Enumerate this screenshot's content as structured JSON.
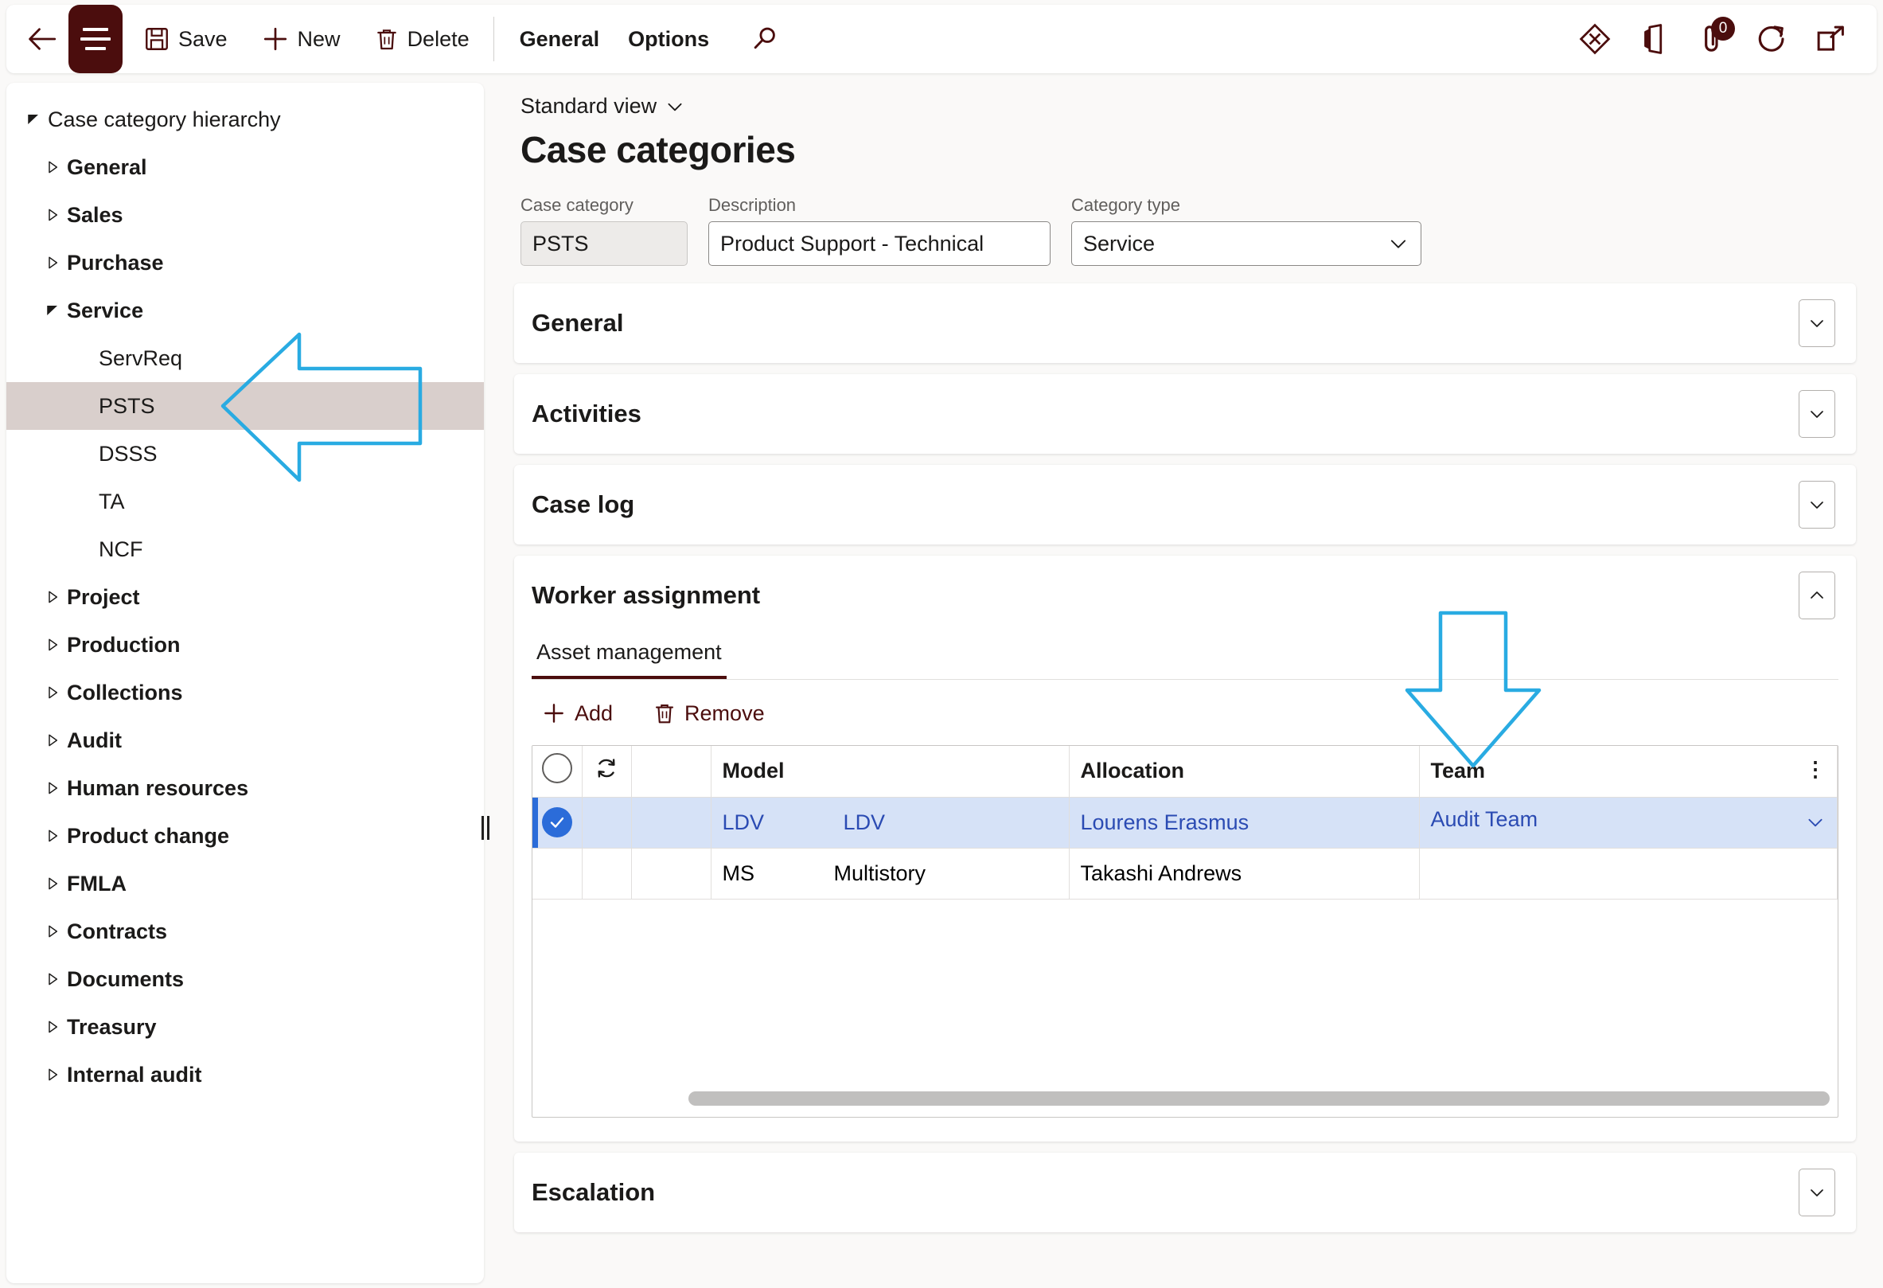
{
  "toolbar": {
    "back_label": "Back",
    "menu_icon": "hamburger-menu-icon",
    "save_label": "Save",
    "new_label": "New",
    "delete_label": "Delete",
    "general_label": "General",
    "options_label": "Options",
    "search_label": "Search",
    "right_icons": [
      {
        "name": "dynamics-icon",
        "label": "Dynamics 365"
      },
      {
        "name": "office-apps-icon",
        "label": "Office apps"
      },
      {
        "name": "attachments-icon",
        "label": "Attachments",
        "badge": "0"
      },
      {
        "name": "refresh-icon",
        "label": "Refresh"
      },
      {
        "name": "open-in-new-icon",
        "label": "Open in new window"
      }
    ]
  },
  "sidebar": {
    "root": {
      "label": "Case category hierarchy",
      "expanded": true
    },
    "items": [
      {
        "label": "General",
        "level": 1,
        "expanded": false
      },
      {
        "label": "Sales",
        "level": 1,
        "expanded": false
      },
      {
        "label": "Purchase",
        "level": 1,
        "expanded": false
      },
      {
        "label": "Service",
        "level": 1,
        "expanded": true
      },
      {
        "label": "ServReq",
        "level": 2,
        "selected": false
      },
      {
        "label": "PSTS",
        "level": 2,
        "selected": true
      },
      {
        "label": "DSSS",
        "level": 2,
        "selected": false
      },
      {
        "label": "TA",
        "level": 2,
        "selected": false
      },
      {
        "label": "NCF",
        "level": 2,
        "selected": false
      },
      {
        "label": "Project",
        "level": 1,
        "expanded": false
      },
      {
        "label": "Production",
        "level": 1,
        "expanded": false
      },
      {
        "label": "Collections",
        "level": 1,
        "expanded": false
      },
      {
        "label": "Audit",
        "level": 1,
        "expanded": false
      },
      {
        "label": "Human resources",
        "level": 1,
        "expanded": false
      },
      {
        "label": "Product change",
        "level": 1,
        "expanded": false
      },
      {
        "label": "FMLA",
        "level": 1,
        "expanded": false
      },
      {
        "label": "Contracts",
        "level": 1,
        "expanded": false
      },
      {
        "label": "Documents",
        "level": 1,
        "expanded": false
      },
      {
        "label": "Treasury",
        "level": 1,
        "expanded": false
      },
      {
        "label": "Internal audit",
        "level": 1,
        "expanded": false
      }
    ]
  },
  "header": {
    "view_selector": "Standard view",
    "page_title": "Case categories"
  },
  "fields": {
    "case_category": {
      "label": "Case category",
      "value": "PSTS",
      "readonly": true
    },
    "description": {
      "label": "Description",
      "value": "Product Support - Technical"
    },
    "category_type": {
      "label": "Category type",
      "value": "Service"
    }
  },
  "sections": [
    {
      "id": "general",
      "title": "General",
      "expanded": false
    },
    {
      "id": "activities",
      "title": "Activities",
      "expanded": false
    },
    {
      "id": "case_log",
      "title": "Case log",
      "expanded": false
    },
    {
      "id": "worker_assignment",
      "title": "Worker assignment",
      "expanded": true
    },
    {
      "id": "escalation",
      "title": "Escalation",
      "expanded": false
    }
  ],
  "worker_assignment": {
    "tabs": [
      {
        "label": "Asset management",
        "active": true
      }
    ],
    "tools": [
      {
        "name": "add-button",
        "label": "Add",
        "icon": "plus-icon"
      },
      {
        "name": "remove-button",
        "label": "Remove",
        "icon": "trash-icon"
      }
    ],
    "grid": {
      "columns": [
        {
          "key": "select",
          "label": "",
          "icon": "select-all-circle-icon"
        },
        {
          "key": "refresh",
          "label": "",
          "icon": "row-refresh-icon"
        },
        {
          "key": "blank",
          "label": ""
        },
        {
          "key": "model",
          "label": "Model"
        },
        {
          "key": "allocation",
          "label": "Allocation"
        },
        {
          "key": "team",
          "label": "Team"
        }
      ],
      "rows": [
        {
          "selected": true,
          "model_code": "LDV",
          "model_name": "LDV",
          "allocation": "Lourens Erasmus",
          "team": "Audit Team"
        },
        {
          "selected": false,
          "model_code": "MS",
          "model_name": "Multistory",
          "allocation": "Takashi Andrews",
          "team": ""
        }
      ],
      "kebab_label": "⋮"
    }
  },
  "colors": {
    "brand": "#4b0d0d",
    "selected_tree_row": "#d9cfcc",
    "selected_grid_row": "#d6e2f7",
    "grid_link_text": "#2b4bb3",
    "annotation_arrow": "#29abe2"
  },
  "annotations": [
    {
      "name": "arrow-pointing-to-psts",
      "direction": "left",
      "color": "#29abe2"
    },
    {
      "name": "arrow-pointing-to-team-column",
      "direction": "down",
      "color": "#29abe2"
    }
  ]
}
